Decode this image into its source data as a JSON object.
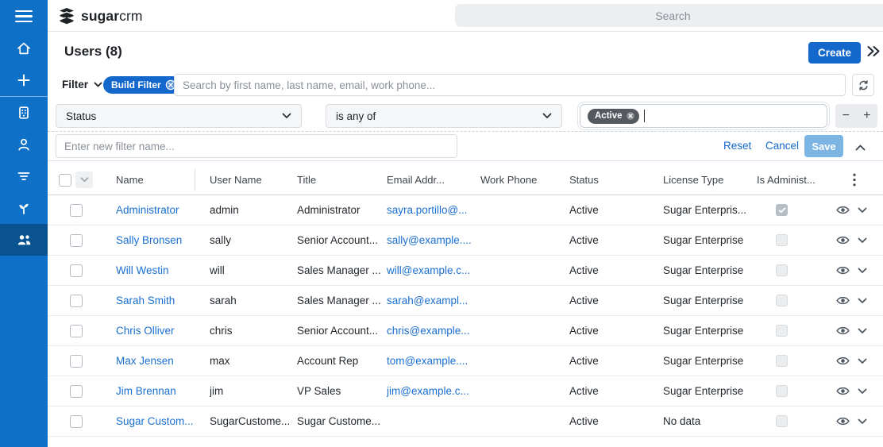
{
  "topbar": {
    "logo_bold": "sugar",
    "logo_light": "crm",
    "search_placeholder": "Search"
  },
  "sidebar": {
    "items": [
      {
        "icon": "home-icon"
      },
      {
        "icon": "plus-icon"
      },
      {
        "icon": "building-icon"
      },
      {
        "icon": "person-icon"
      },
      {
        "icon": "filter-lines-icon"
      },
      {
        "icon": "sprout-icon"
      },
      {
        "icon": "users-icon",
        "active": true
      }
    ]
  },
  "header": {
    "title": "Users (8)",
    "create_label": "Create"
  },
  "filter": {
    "label": "Filter",
    "pill_label": "Build Filter",
    "search_placeholder": "Search by first name, last name, email, work phone...",
    "field_value": "Status",
    "operator_value": "is any of",
    "value_tag": "Active",
    "minus_label": "−",
    "plus_label": "+",
    "name_placeholder": "Enter new filter name...",
    "reset_label": "Reset",
    "cancel_label": "Cancel",
    "save_label": "Save"
  },
  "table": {
    "columns": [
      "Name",
      "User Name",
      "Title",
      "Email Addr...",
      "Work Phone",
      "Status",
      "License Type",
      "Is Administ..."
    ],
    "rows": [
      {
        "name": "Administrator",
        "username": "admin",
        "title": "Administrator",
        "email": "sayra.portillo@...",
        "work_phone": "",
        "status": "Active",
        "license": "Sugar Enterpris...",
        "is_admin": true
      },
      {
        "name": "Sally Bronsen",
        "username": "sally",
        "title": "Senior Account...",
        "email": "sally@example....",
        "work_phone": "",
        "status": "Active",
        "license": "Sugar Enterprise",
        "is_admin": false
      },
      {
        "name": "Will Westin",
        "username": "will",
        "title": "Sales Manager ...",
        "email": "will@example.c...",
        "work_phone": "",
        "status": "Active",
        "license": "Sugar Enterprise",
        "is_admin": false
      },
      {
        "name": "Sarah Smith",
        "username": "sarah",
        "title": "Sales Manager ...",
        "email": "sarah@exampl...",
        "work_phone": "",
        "status": "Active",
        "license": "Sugar Enterprise",
        "is_admin": false
      },
      {
        "name": "Chris Olliver",
        "username": "chris",
        "title": "Senior Account...",
        "email": "chris@example...",
        "work_phone": "",
        "status": "Active",
        "license": "Sugar Enterprise",
        "is_admin": false
      },
      {
        "name": "Max Jensen",
        "username": "max",
        "title": "Account Rep",
        "email": "tom@example....",
        "work_phone": "",
        "status": "Active",
        "license": "Sugar Enterprise",
        "is_admin": false
      },
      {
        "name": "Jim Brennan",
        "username": "jim",
        "title": "VP Sales",
        "email": "jim@example.c...",
        "work_phone": "",
        "status": "Active",
        "license": "Sugar Enterprise",
        "is_admin": false
      },
      {
        "name": "Sugar Custom...",
        "username": "SugarCustome...",
        "title": "Sugar Custome...",
        "email": "",
        "work_phone": "",
        "status": "Active",
        "license": "No data",
        "is_admin": false
      }
    ]
  },
  "colors": {
    "sidebar_blue": "#0e70c6",
    "sidebar_active_blue": "#085390",
    "accent_blue": "#1468cb",
    "link_blue": "#1a6fd0",
    "save_disabled_blue": "#7cb5e4",
    "tag_dark": "#54585f"
  }
}
